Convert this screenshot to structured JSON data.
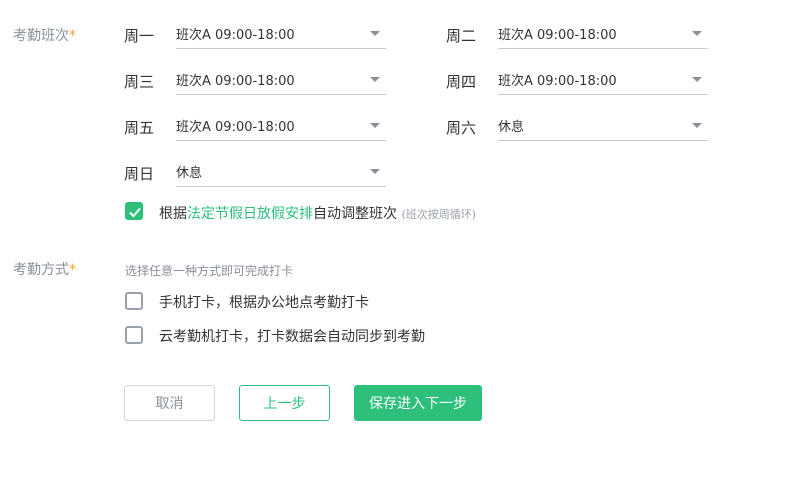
{
  "schedule": {
    "label": "考勤班次",
    "required_mark": "*",
    "days": [
      {
        "day": "周一",
        "value": "班次A 09:00-18:00"
      },
      {
        "day": "周二",
        "value": "班次A 09:00-18:00"
      },
      {
        "day": "周三",
        "value": "班次A 09:00-18:00"
      },
      {
        "day": "周四",
        "value": "班次A 09:00-18:00"
      },
      {
        "day": "周五",
        "value": "班次A 09:00-18:00"
      },
      {
        "day": "周六",
        "value": "休息"
      },
      {
        "day": "周日",
        "value": "休息"
      }
    ],
    "holiday": {
      "checked": true,
      "prefix": "根据",
      "link": "法定节假日放假安排",
      "suffix": "自动调整班次",
      "hint": "(班次按周循环)"
    }
  },
  "method": {
    "label": "考勤方式",
    "required_mark": "*",
    "hint": "选择任意一种方式即可完成打卡",
    "options": [
      {
        "label": "手机打卡，根据办公地点考勤打卡",
        "checked": false
      },
      {
        "label": "云考勤机打卡，打卡数据会自动同步到考勤",
        "checked": false
      }
    ]
  },
  "buttons": {
    "cancel": "取消",
    "prev": "上一步",
    "next": "保存进入下一步"
  },
  "colors": {
    "accent": "#2ec07b",
    "required": "#f5a623"
  }
}
